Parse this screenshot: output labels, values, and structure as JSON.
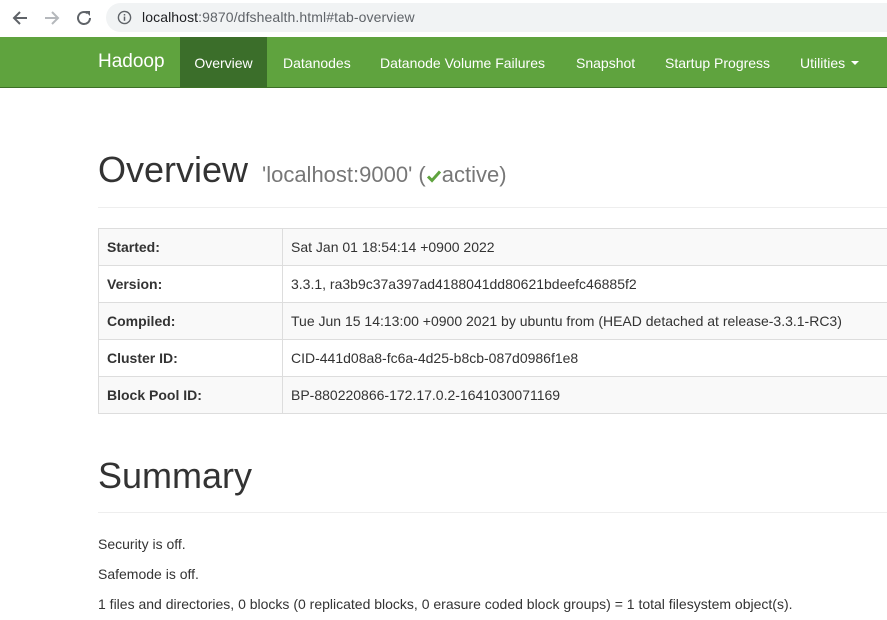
{
  "browser": {
    "url_host": "localhost",
    "url_rest": ":9870/dfshealth.html#tab-overview"
  },
  "navbar": {
    "brand": "Hadoop",
    "items": [
      {
        "label": "Overview"
      },
      {
        "label": "Datanodes"
      },
      {
        "label": "Datanode Volume Failures"
      },
      {
        "label": "Snapshot"
      },
      {
        "label": "Startup Progress"
      },
      {
        "label": "Utilities"
      }
    ],
    "color": "#5fa33e",
    "active_color": "#3b6e2a"
  },
  "overview": {
    "title": "Overview",
    "host": "'localhost:9000'",
    "paren_open": "(",
    "status": "active",
    "paren_close": ")",
    "rows": [
      {
        "label": "Started:",
        "value": "Sat Jan 01 18:54:14 +0900 2022"
      },
      {
        "label": "Version:",
        "value": "3.3.1, ra3b9c37a397ad4188041dd80621bdeefc46885f2"
      },
      {
        "label": "Compiled:",
        "value": "Tue Jun 15 14:13:00 +0900 2021 by ubuntu from (HEAD detached at release-3.3.1-RC3)"
      },
      {
        "label": "Cluster ID:",
        "value": "CID-441d08a8-fc6a-4d25-b8cb-087d0986f1e8"
      },
      {
        "label": "Block Pool ID:",
        "value": "BP-880220866-172.17.0.2-1641030071169"
      }
    ]
  },
  "summary": {
    "title": "Summary",
    "lines": [
      "Security is off.",
      "Safemode is off.",
      "1 files and directories, 0 blocks (0 replicated blocks, 0 erasure coded block groups) = 1 total filesystem object(s)."
    ]
  }
}
